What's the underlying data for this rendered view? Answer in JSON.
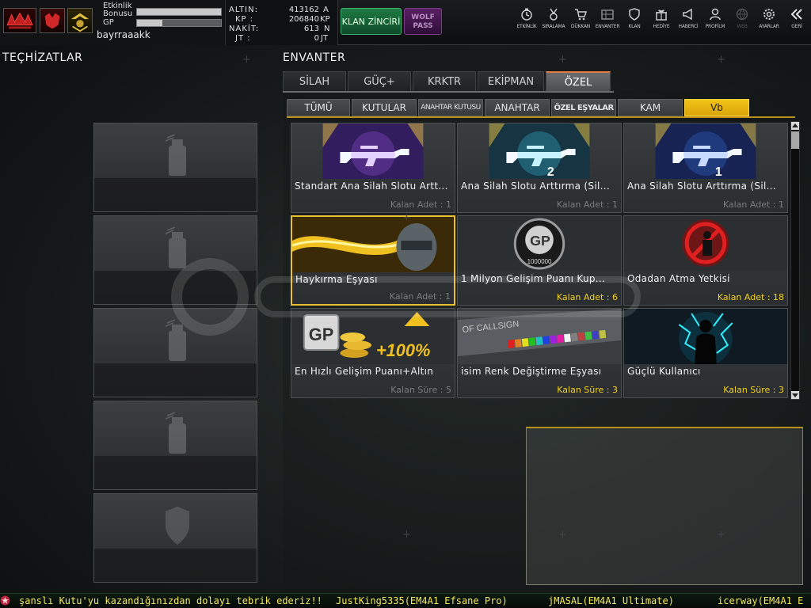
{
  "profile": {
    "etkinlik_label": "Etkinlik\nBonusu",
    "etkinlik_line1": "Etkinlik",
    "etkinlik_line2": "Bonusu",
    "etkinlik_progress": 1.0,
    "gp_label": "GP",
    "gp_progress": 0.3,
    "username": "bayrraaakk"
  },
  "currency": {
    "rows": [
      {
        "label": "ALTIN:",
        "value": "413162",
        "unit": "A"
      },
      {
        "label": "KP :",
        "value": "206840",
        "unit": "KP"
      },
      {
        "label": "NAKİT:",
        "value": "613",
        "unit": "N"
      },
      {
        "label": "JT :",
        "value": "0",
        "unit": "JT"
      }
    ]
  },
  "buttons": {
    "klan_zinciri": "KLAN ZİNCİRİ",
    "wolf_pass_line1": "WOLF",
    "wolf_pass_line2": "PASS"
  },
  "topnav": [
    {
      "label": "ETKİNLİK",
      "icon": "clock-icon",
      "enabled": true
    },
    {
      "label": "SIRALAMA",
      "icon": "medal-icon",
      "enabled": true
    },
    {
      "label": "DÜKKAN",
      "icon": "cart-icon",
      "enabled": true
    },
    {
      "label": "ENVANTER",
      "icon": "inventory-icon",
      "enabled": true
    },
    {
      "label": "KLAN",
      "icon": "shield-icon",
      "enabled": true
    },
    {
      "label": "HEDİYE",
      "icon": "gift-icon",
      "enabled": true
    },
    {
      "label": "HABERCİ",
      "icon": "megaphone-icon",
      "enabled": true
    },
    {
      "label": "PROFİLM",
      "icon": "profile-icon",
      "enabled": true
    },
    {
      "label": "WEB",
      "icon": "globe-icon",
      "enabled": false
    },
    {
      "label": "AYARLAR",
      "icon": "gear-icon",
      "enabled": true
    },
    {
      "label": "GERİ",
      "icon": "back-icon",
      "enabled": true
    }
  ],
  "left": {
    "title": "TEÇHİZATLAR",
    "slots": [
      "grenade-slot",
      "grenade-slot",
      "grenade-slot",
      "grenade-slot",
      "armor-slot"
    ]
  },
  "inventory": {
    "title": "ENVANTER",
    "main_tabs": [
      "SİLAH",
      "GÜÇ+",
      "KRKTR",
      "EKİPMAN",
      "ÖZEL"
    ],
    "active_main_tab": 4,
    "sub_tabs": [
      "TÜMÜ",
      "KUTULAR",
      "ANAHTAR KUTUSU",
      "ANAHTAR",
      "ÖZEL EŞYALAR",
      "KAM",
      "Vb"
    ],
    "active_sub_tab": 6,
    "items": [
      {
        "name": "Standart Ana Silah Slotu Artt...",
        "count": "Kalan Adet : 1",
        "highlight": false,
        "image": "purple-rifle",
        "badge": ""
      },
      {
        "name": "Ana Silah Slotu Arttırma (Sil...",
        "count": "Kalan Adet : 1",
        "highlight": false,
        "image": "cyan-rifle",
        "badge": "2"
      },
      {
        "name": "Ana Silah Slotu Arttırma (Sil...",
        "count": "Kalan Adet : 1",
        "highlight": false,
        "image": "blue-rifle",
        "badge": "1"
      },
      {
        "name": "Haykırma Eşyası",
        "count": "Kalan Adet : 1",
        "highlight": false,
        "image": "soldier-shout",
        "badge": ""
      },
      {
        "name": "1 Milyon Gelişim Puanı Kup...",
        "count": "Kalan Adet : 6",
        "highlight": true,
        "image": "gp-coin",
        "badge": "1000000"
      },
      {
        "name": "Odadan Atma Yetkisi",
        "count": "Kalan Adet : 18",
        "highlight": true,
        "image": "kick-sign",
        "badge": ""
      },
      {
        "name": "En Hızlı Gelişim Puanı+Altın",
        "count": "Kalan Süre : 5",
        "highlight": false,
        "image": "gp-gold",
        "badge": "+100%"
      },
      {
        "name": "isim Renk Değiştirme Eşyası",
        "count": "Kalan Süre : 3",
        "highlight": true,
        "image": "callsign",
        "badge": "OF CALLSIGN"
      },
      {
        "name": "Güçlü Kullanıcı",
        "count": "Kalan Süre : 3",
        "highlight": true,
        "image": "power-user",
        "badge": ""
      }
    ]
  },
  "ticker": {
    "messages": [
      "şanslı Kutu'yu kazandığınızdan dolayı tebrik ederiz!!",
      "JustKing5335(EM4A1 Efsane Pro)",
      "jMASAL(EM4A1 Ultimate)",
      "icerway(EM4A1 E"
    ]
  },
  "colors": {
    "accent_yellow": "#f3c216",
    "active_tab_orange": "#e07a40",
    "ticker_text": "#f5e85a"
  }
}
